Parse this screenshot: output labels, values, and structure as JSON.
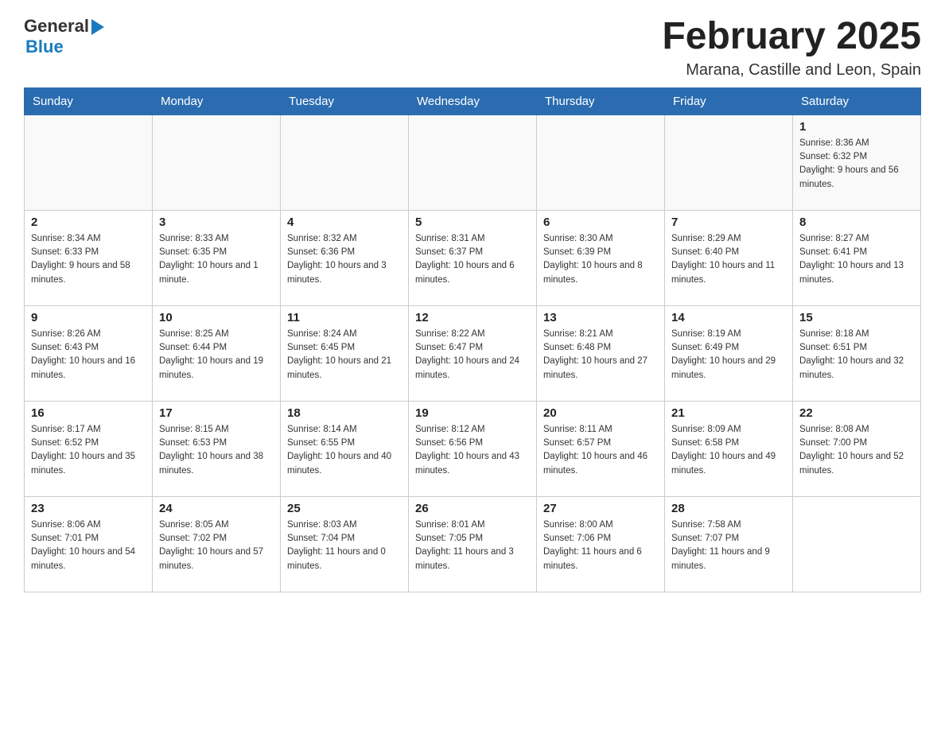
{
  "header": {
    "logo_general": "General",
    "logo_blue": "Blue",
    "month_title": "February 2025",
    "location": "Marana, Castille and Leon, Spain"
  },
  "weekdays": [
    "Sunday",
    "Monday",
    "Tuesday",
    "Wednesday",
    "Thursday",
    "Friday",
    "Saturday"
  ],
  "weeks": [
    {
      "days": [
        {
          "number": "",
          "info": ""
        },
        {
          "number": "",
          "info": ""
        },
        {
          "number": "",
          "info": ""
        },
        {
          "number": "",
          "info": ""
        },
        {
          "number": "",
          "info": ""
        },
        {
          "number": "",
          "info": ""
        },
        {
          "number": "1",
          "info": "Sunrise: 8:36 AM\nSunset: 6:32 PM\nDaylight: 9 hours and 56 minutes."
        }
      ]
    },
    {
      "days": [
        {
          "number": "2",
          "info": "Sunrise: 8:34 AM\nSunset: 6:33 PM\nDaylight: 9 hours and 58 minutes."
        },
        {
          "number": "3",
          "info": "Sunrise: 8:33 AM\nSunset: 6:35 PM\nDaylight: 10 hours and 1 minute."
        },
        {
          "number": "4",
          "info": "Sunrise: 8:32 AM\nSunset: 6:36 PM\nDaylight: 10 hours and 3 minutes."
        },
        {
          "number": "5",
          "info": "Sunrise: 8:31 AM\nSunset: 6:37 PM\nDaylight: 10 hours and 6 minutes."
        },
        {
          "number": "6",
          "info": "Sunrise: 8:30 AM\nSunset: 6:39 PM\nDaylight: 10 hours and 8 minutes."
        },
        {
          "number": "7",
          "info": "Sunrise: 8:29 AM\nSunset: 6:40 PM\nDaylight: 10 hours and 11 minutes."
        },
        {
          "number": "8",
          "info": "Sunrise: 8:27 AM\nSunset: 6:41 PM\nDaylight: 10 hours and 13 minutes."
        }
      ]
    },
    {
      "days": [
        {
          "number": "9",
          "info": "Sunrise: 8:26 AM\nSunset: 6:43 PM\nDaylight: 10 hours and 16 minutes."
        },
        {
          "number": "10",
          "info": "Sunrise: 8:25 AM\nSunset: 6:44 PM\nDaylight: 10 hours and 19 minutes."
        },
        {
          "number": "11",
          "info": "Sunrise: 8:24 AM\nSunset: 6:45 PM\nDaylight: 10 hours and 21 minutes."
        },
        {
          "number": "12",
          "info": "Sunrise: 8:22 AM\nSunset: 6:47 PM\nDaylight: 10 hours and 24 minutes."
        },
        {
          "number": "13",
          "info": "Sunrise: 8:21 AM\nSunset: 6:48 PM\nDaylight: 10 hours and 27 minutes."
        },
        {
          "number": "14",
          "info": "Sunrise: 8:19 AM\nSunset: 6:49 PM\nDaylight: 10 hours and 29 minutes."
        },
        {
          "number": "15",
          "info": "Sunrise: 8:18 AM\nSunset: 6:51 PM\nDaylight: 10 hours and 32 minutes."
        }
      ]
    },
    {
      "days": [
        {
          "number": "16",
          "info": "Sunrise: 8:17 AM\nSunset: 6:52 PM\nDaylight: 10 hours and 35 minutes."
        },
        {
          "number": "17",
          "info": "Sunrise: 8:15 AM\nSunset: 6:53 PM\nDaylight: 10 hours and 38 minutes."
        },
        {
          "number": "18",
          "info": "Sunrise: 8:14 AM\nSunset: 6:55 PM\nDaylight: 10 hours and 40 minutes."
        },
        {
          "number": "19",
          "info": "Sunrise: 8:12 AM\nSunset: 6:56 PM\nDaylight: 10 hours and 43 minutes."
        },
        {
          "number": "20",
          "info": "Sunrise: 8:11 AM\nSunset: 6:57 PM\nDaylight: 10 hours and 46 minutes."
        },
        {
          "number": "21",
          "info": "Sunrise: 8:09 AM\nSunset: 6:58 PM\nDaylight: 10 hours and 49 minutes."
        },
        {
          "number": "22",
          "info": "Sunrise: 8:08 AM\nSunset: 7:00 PM\nDaylight: 10 hours and 52 minutes."
        }
      ]
    },
    {
      "days": [
        {
          "number": "23",
          "info": "Sunrise: 8:06 AM\nSunset: 7:01 PM\nDaylight: 10 hours and 54 minutes."
        },
        {
          "number": "24",
          "info": "Sunrise: 8:05 AM\nSunset: 7:02 PM\nDaylight: 10 hours and 57 minutes."
        },
        {
          "number": "25",
          "info": "Sunrise: 8:03 AM\nSunset: 7:04 PM\nDaylight: 11 hours and 0 minutes."
        },
        {
          "number": "26",
          "info": "Sunrise: 8:01 AM\nSunset: 7:05 PM\nDaylight: 11 hours and 3 minutes."
        },
        {
          "number": "27",
          "info": "Sunrise: 8:00 AM\nSunset: 7:06 PM\nDaylight: 11 hours and 6 minutes."
        },
        {
          "number": "28",
          "info": "Sunrise: 7:58 AM\nSunset: 7:07 PM\nDaylight: 11 hours and 9 minutes."
        },
        {
          "number": "",
          "info": ""
        }
      ]
    }
  ]
}
